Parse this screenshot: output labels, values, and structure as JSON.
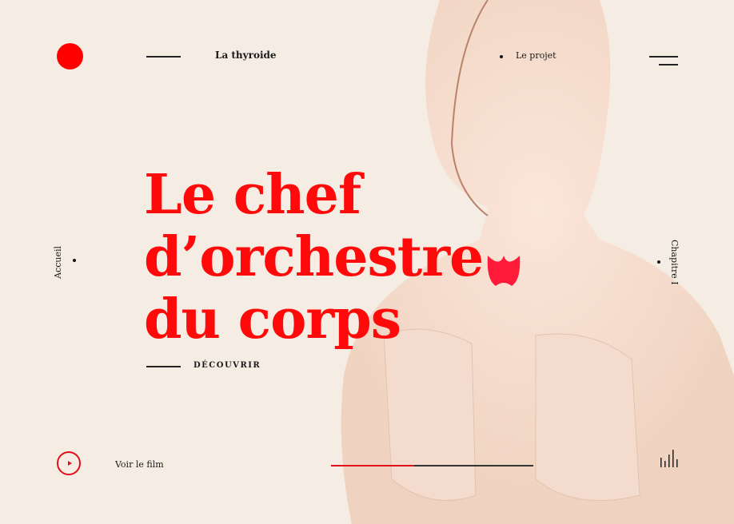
{
  "header": {
    "brand": "La thyroide",
    "nav_link": "Le projet"
  },
  "hero": {
    "title_lines": [
      "Le chef",
      "d’orchestre",
      "du corps"
    ],
    "cta": "DÉCOUVRIR"
  },
  "side": {
    "left": "Accueil",
    "right": "Chapitre I"
  },
  "footer": {
    "video_label": "Voir le film",
    "progress_percent": 41
  },
  "colors": {
    "accent": "#ff0000",
    "background": "#f5ede3"
  }
}
